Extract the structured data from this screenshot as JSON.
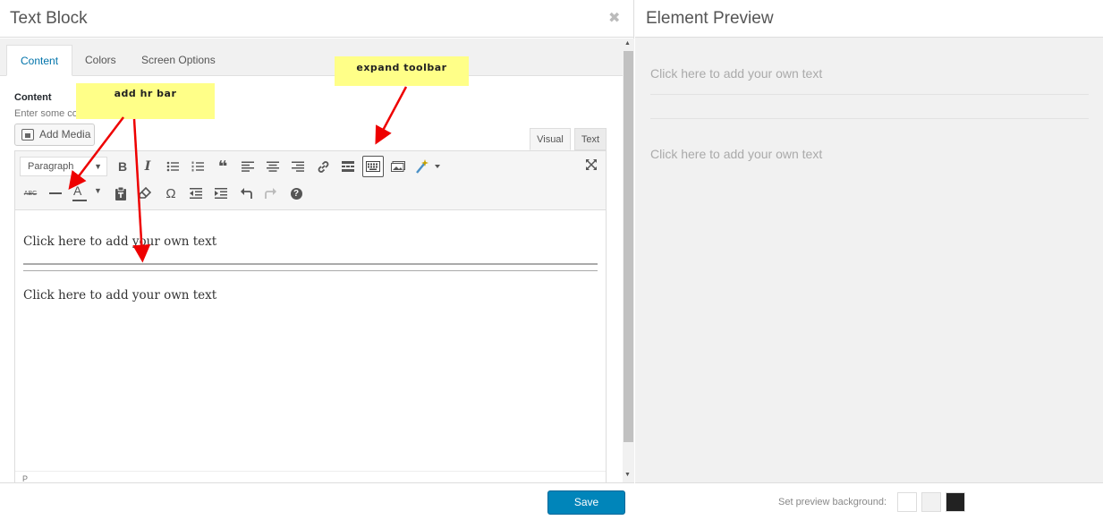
{
  "dialog": {
    "title": "Text Block",
    "close_glyph": "✖"
  },
  "tabs": [
    {
      "label": "Content"
    },
    {
      "label": "Colors"
    },
    {
      "label": "Screen Options"
    }
  ],
  "content_field": {
    "label": "Content",
    "description": "Enter some co"
  },
  "add_media_label": "Add Media",
  "editor_tabs": {
    "visual": "Visual",
    "text": "Text"
  },
  "toolbar": {
    "format_select": "Paragraph",
    "row1_icons": [
      "bold-icon",
      "italic-icon",
      "bullet-list-icon",
      "numbered-list-icon",
      "blockquote-icon",
      "align-left-icon",
      "align-center-icon",
      "align-right-icon",
      "link-icon",
      "read-more-icon",
      "toolbar-toggle-icon",
      "image-icon",
      "magic-wand-icon"
    ],
    "row2_icons": [
      "strikethrough-icon",
      "horizontal-line-icon",
      "text-color-icon",
      "paste-text-icon",
      "clear-formatting-icon",
      "special-character-icon",
      "outdent-icon",
      "indent-icon",
      "undo-icon",
      "redo-icon",
      "help-icon"
    ],
    "strike_glyph": "ABC",
    "bold_glyph": "B",
    "italic_glyph": "I",
    "quote_glyph": "❝",
    "omega_glyph": "Ω",
    "color_glyph": "A",
    "help_glyph": "?"
  },
  "editor_content": {
    "line1": "Click here to add your own text",
    "line2": "Click here to add your own text",
    "path": "P"
  },
  "footer": {
    "save_label": "Save"
  },
  "preview": {
    "title": "Element Preview",
    "line1": "Click here to add your own text",
    "line2": "Click here to add your own text",
    "bg_label": "Set preview background:",
    "swatches": [
      "#ffffff",
      "#f1f1f1",
      "#222222"
    ]
  },
  "annotations": {
    "expand": "expand toolbar",
    "hr": "add hr bar",
    "arrow_color": "#ee0000"
  },
  "colors": {
    "accent": "#0073aa",
    "save": "#0085ba"
  }
}
